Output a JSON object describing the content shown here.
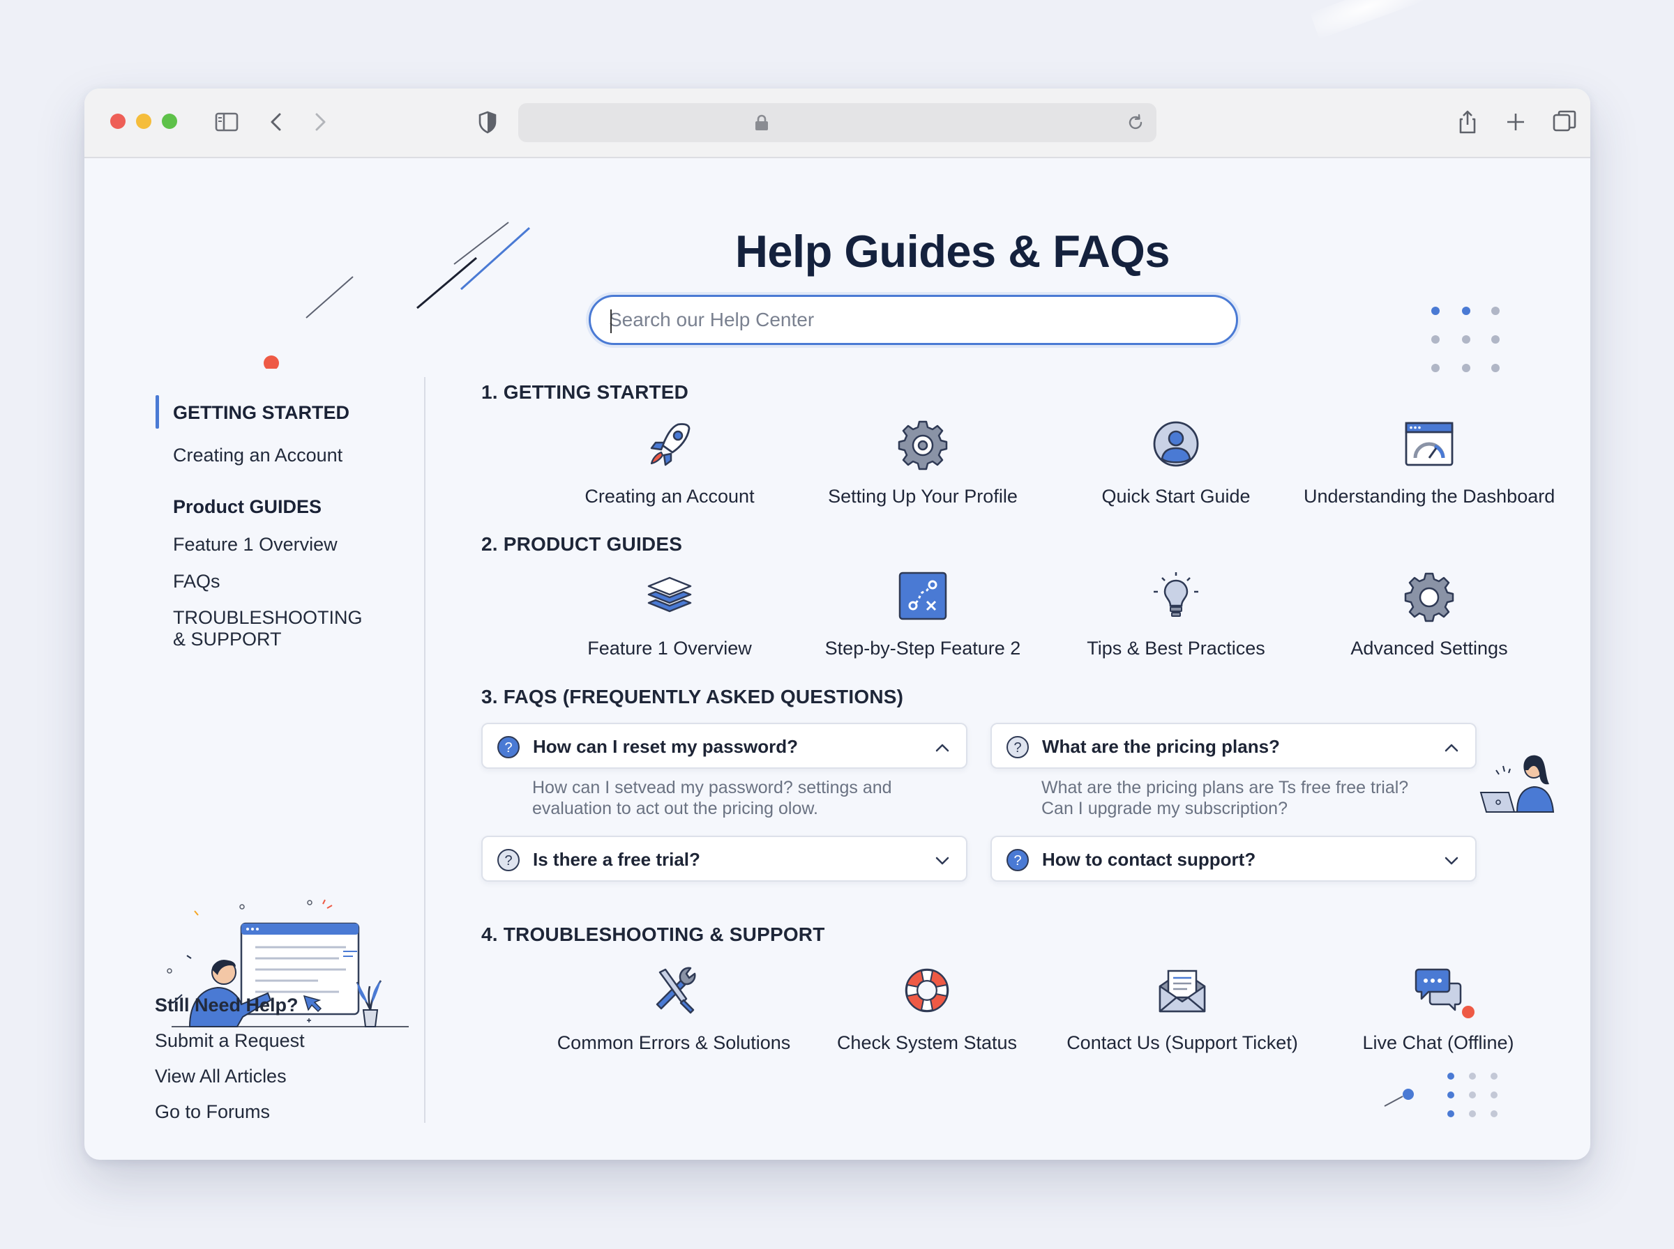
{
  "browser": {
    "toolbar_icons": [
      "sidebar-icon",
      "back-icon",
      "forward-icon",
      "privacy-shield-icon",
      "lock-icon",
      "reload-icon",
      "share-icon",
      "new-tab-icon",
      "tabs-overview-icon"
    ]
  },
  "page": {
    "title": "Help Guides & FAQs",
    "search_placeholder": "Search our Help Center"
  },
  "sidebar": {
    "items": [
      {
        "label": "GETTING STARTED",
        "active": true
      },
      {
        "label": "Creating an Account"
      },
      {
        "label": "Product GUIDES"
      },
      {
        "label": "Feature 1 Overview"
      },
      {
        "label": "FAQs"
      },
      {
        "label": "TROUBLESHOOTING"
      },
      {
        "label": "& SUPPORT"
      }
    ],
    "help": {
      "title": "Still Need Help?",
      "links": [
        "Submit a Request",
        "View All Articles",
        "Go to Forums"
      ]
    }
  },
  "sections": {
    "getting_started": {
      "title": "1. GETTING STARTED",
      "cards": [
        {
          "label": "Creating an Account",
          "icon": "rocket-icon"
        },
        {
          "label": "Setting Up Your Profile",
          "icon": "gear-icon"
        },
        {
          "label": "Quick Start Guide",
          "icon": "user-icon"
        },
        {
          "label": "Understanding the Dashboard",
          "icon": "dashboard-icon"
        }
      ]
    },
    "product_guides": {
      "title": "2. PRODUCT GUIDES",
      "cards": [
        {
          "label": "Feature 1 Overview",
          "icon": "layers-icon"
        },
        {
          "label": "Step-by-Step Feature 2",
          "icon": "path-steps-icon"
        },
        {
          "label": "Tips & Best Practices",
          "icon": "lightbulb-icon"
        },
        {
          "label": "Advanced Settings",
          "icon": "gear-icon"
        }
      ]
    },
    "faqs": {
      "title": "3. FAQS (FREQUENTLY ASKED QUESTIONS)",
      "items": [
        {
          "question": "How can I reset my password?",
          "expanded": true,
          "answer": [
            "How can I setvead my password? settings and",
            "evaluation to act out the pricing olow."
          ]
        },
        {
          "question": "What are the pricing plans?",
          "expanded": true,
          "answer": [
            "What are the pricing plans are Ts free free trial?",
            "Can I upgrade my subscription?"
          ]
        },
        {
          "question": "Is there a free trial?",
          "expanded": false
        },
        {
          "question": "How to contact support?",
          "expanded": false
        }
      ]
    },
    "support": {
      "title": "4. TROUBLESHOOTING & SUPPORT",
      "cards": [
        {
          "label": "Common Errors & Solutions",
          "icon": "tools-icon"
        },
        {
          "label": "Check System Status",
          "icon": "lifebuoy-icon"
        },
        {
          "label": "Contact Us (Support Ticket)",
          "icon": "envelope-icon"
        },
        {
          "label": "Live Chat (Offline)",
          "icon": "chat-icon"
        }
      ]
    }
  },
  "colors": {
    "accent": "#4a7ad4",
    "title": "#14213d",
    "decor_red": "#ee5a45"
  }
}
